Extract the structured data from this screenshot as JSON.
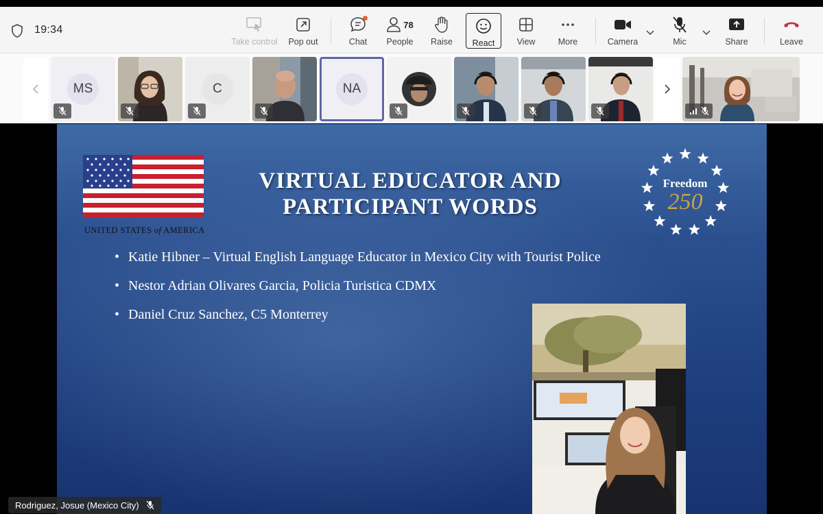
{
  "toolbar": {
    "time": "19:34",
    "take_control": "Take control",
    "pop_out": "Pop out",
    "chat": "Chat",
    "people": "People",
    "people_count": "78",
    "raise": "Raise",
    "react": "React",
    "view": "View",
    "more": "More",
    "camera": "Camera",
    "mic": "Mic",
    "share": "Share",
    "leave": "Leave"
  },
  "participants": [
    {
      "initials": "MS",
      "muted": true
    },
    {
      "initials": "",
      "muted": true
    },
    {
      "initials": "C",
      "muted": true
    },
    {
      "initials": "",
      "muted": true
    },
    {
      "initials": "NA",
      "muted": false,
      "selected": true
    },
    {
      "initials": "",
      "muted": true
    },
    {
      "initials": "",
      "muted": true
    },
    {
      "initials": "",
      "muted": true
    },
    {
      "initials": "",
      "muted": true
    },
    {
      "initials": "",
      "muted": true,
      "self": true
    }
  ],
  "slide": {
    "country_caption_1": "UNITED STATES ",
    "country_caption_2": "of",
    "country_caption_3": " AMERICA",
    "title_line1": "VIRTUAL EDUCATOR AND",
    "title_line2": "PARTICIPANT WORDS",
    "logo_word": "Freedom",
    "logo_number": "250",
    "bullets": [
      "Katie Hibner – Virtual English Language Educator in Mexico City with Tourist Police",
      "Nestor Adrian Olivares Garcia, Policia Turistica CDMX",
      "Daniel Cruz Sanchez, C5 Monterrey"
    ]
  },
  "presenter": {
    "name": "Rodriguez, Josue (Mexico City)"
  },
  "colors": {
    "accent": "#6264a7",
    "leave": "#c4314b",
    "slide_bg": "#24467f",
    "badge": "#e8642a"
  }
}
